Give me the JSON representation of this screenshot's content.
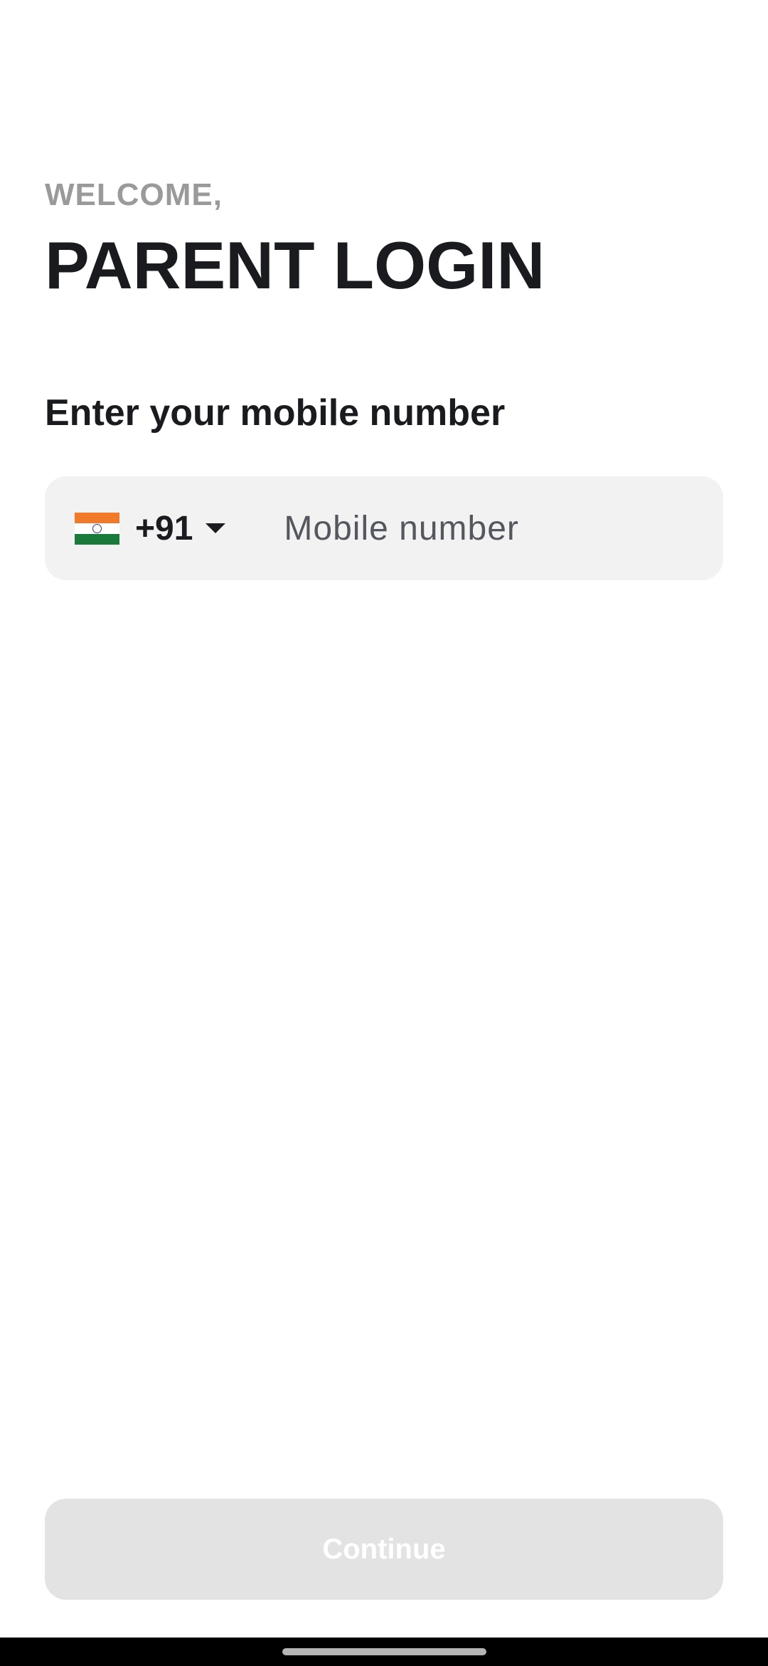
{
  "header": {
    "welcome": "WELCOME,",
    "title": "PARENT LOGIN"
  },
  "form": {
    "prompt": "Enter your mobile number",
    "country_flag_icon": "india-flag-icon",
    "dial_code": "+91",
    "dropdown_icon": "caret-down-icon",
    "mobile_placeholder": "Mobile number",
    "mobile_value": ""
  },
  "actions": {
    "continue_label": "Continue",
    "continue_enabled": false
  },
  "colors": {
    "title": "#1a1b1f",
    "welcome": "#9a9a9a",
    "input_bg": "#f2f2f2",
    "button_disabled_bg": "#e3e3e3",
    "button_text": "#ffffff"
  }
}
